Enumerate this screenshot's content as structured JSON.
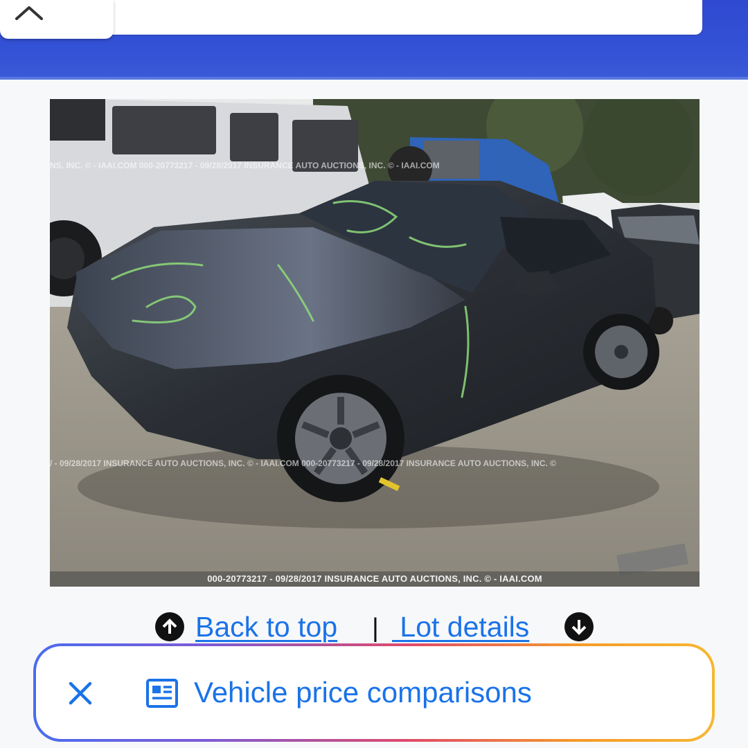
{
  "header": {
    "collapse_icon": "chevron-up-icon",
    "accent_color": "#3453d6"
  },
  "photo": {
    "watermark_top": "NS. INC. © - IAAI.COM      000-20773217 - 09/28/2017 INSURANCE AUTO AUCTIONS, INC. © - IAAI.COM",
    "watermark_mid": "/ - 09/28/2017 INSURANCE AUTO AUCTIONS, INC. © - IAAI.COM    000-20773217 - 09/28/2017 INSURANCE AUTO AUCTIONS, INC. ©",
    "caption": "000-20773217 - 09/28/2017 INSURANCE AUTO AUCTIONS, INC. © - IAAI.COM"
  },
  "links": {
    "back_to_top": "Back to top",
    "separator": "|",
    "lot_details": " Lot details",
    "up_icon": "arrow-up-circle-icon",
    "down_icon": "arrow-down-circle-icon",
    "link_color": "#1a73e8"
  },
  "chip": {
    "close_icon": "close-icon",
    "news_icon": "news-article-icon",
    "label": "Vehicle price comparisons"
  }
}
